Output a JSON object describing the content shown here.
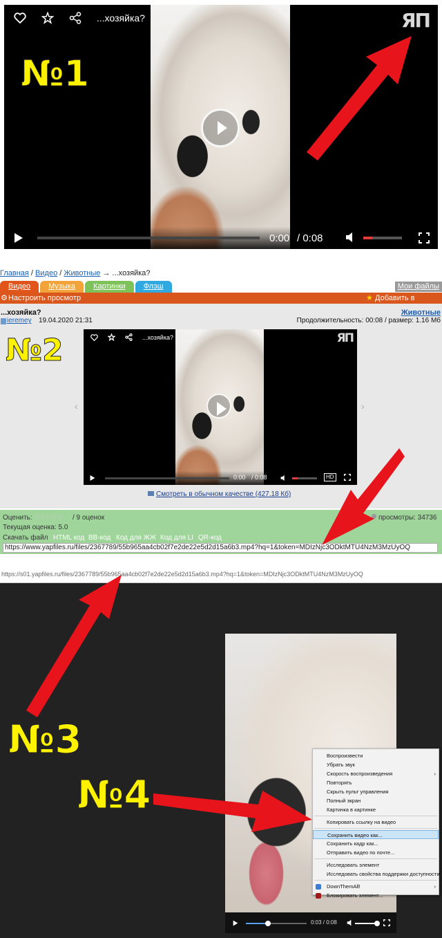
{
  "panel1": {
    "title": "...хозяйка?",
    "label": "№1",
    "brand": "ЯП",
    "time_current": "0:00",
    "time_sep": "/ 0:08"
  },
  "panel2": {
    "breadcrumb": {
      "home": "Главная",
      "sep1": " / ",
      "video": "Видео",
      "sep2": " / ",
      "animals": "Животные",
      "arrow": " → ...хозяйка?"
    },
    "tabs": [
      {
        "label": "Видео",
        "color": "#e2551a"
      },
      {
        "label": "Музыка",
        "color": "#f2a43b"
      },
      {
        "label": "Картинки",
        "color": "#7dc35a"
      },
      {
        "label": "Флэш",
        "color": "#30a9e0"
      }
    ],
    "my_files": "Мои файлы",
    "settings": "Настроить просмотр",
    "bookmark": "Добавить в закладки",
    "file_title": "...хозяйка?",
    "category_link": "Животные",
    "author": "ieremey",
    "date": "19.04.2020 21:31",
    "duration": "Продолжительность: 00:08 / размер: 1.16 Мб",
    "label": "№2",
    "player_title": "...хозяйка?",
    "brand": "ЯП",
    "time_current": "0:00",
    "time_sep": "/ 0:08",
    "hd": "HD",
    "normal_quality": "Смотреть в обычном качестве (427.18 Кб)",
    "rate": "Оценить:",
    "votes": "/ 9 оценок",
    "views": "просмотры: 34736",
    "current_rating": "Текущая оценка: 5.0",
    "download_label": "Скачать файл",
    "download_links": [
      "HTML код",
      "BB-код",
      "Код для ЖЖ",
      "Код для LI",
      "QR-код"
    ],
    "url": "https://www.yapfiles.ru/files/2367789/55b965aa4cb02f7e2de22e5d2d15a6b3.mp4?hq=1&token=MDIzNjc3ODktMTU4NzM3MzUyOQ"
  },
  "panel3": {
    "address": "https://s01.yapfiles.ru/files/2367789/55b965aa4cb02f7e2de22e5d2d15a6b3.mp4?hq=1&token=MDIzNjc3ODktMTU4NzM3MzUyOQ",
    "label3": "№3",
    "label4": "№4",
    "time": "0:03 / 0:08",
    "progress_fraction": 0.375,
    "volume_fraction": 1.0,
    "menu": [
      "Воспроизвести",
      "Убрать звук",
      "Скорость воспроизведения",
      "Повторять",
      "Скрыть пульт управления",
      "Полный экран",
      "Картинка в картинке",
      "Копировать ссылку на видео",
      "Сохранить видео как...",
      "Сохранить кадр как...",
      "Отправить видео по почте...",
      "Исследовать элемент",
      "Исследовать свойства поддержки доступности",
      "DownThemAll!",
      "Блокировать элемент..."
    ]
  }
}
